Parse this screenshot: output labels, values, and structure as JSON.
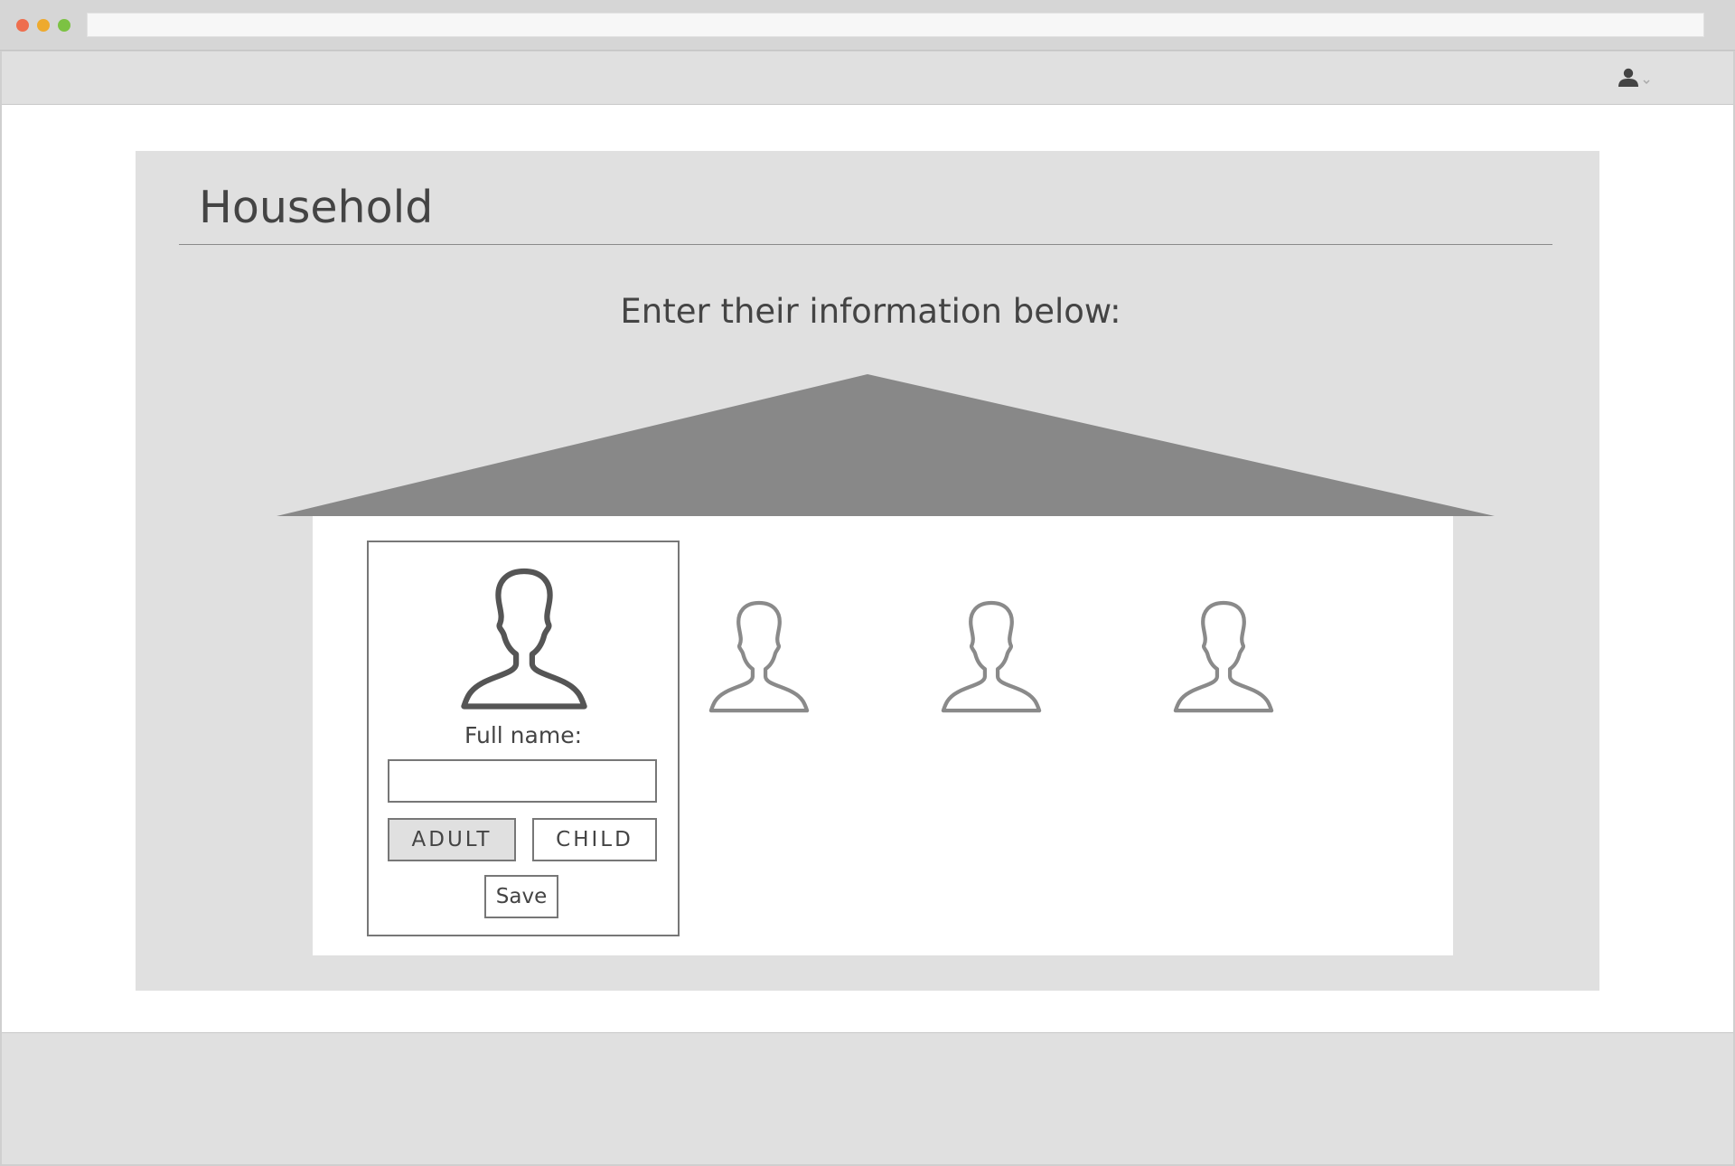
{
  "page": {
    "title": "Household",
    "instructions": "Enter their information below:"
  },
  "member_form": {
    "name_label": "Full name:",
    "name_value": "",
    "name_placeholder": "",
    "adult_label": "ADULT",
    "child_label": "CHILD",
    "selected_type": "ADULT",
    "save_label": "Save"
  },
  "household": {
    "additional_member_slots": 3
  },
  "icons": {
    "user_menu": "user-icon",
    "user_menu_caret": "chevron-down-icon",
    "member": "person-silhouette-icon"
  },
  "colors": {
    "panel_background": "#e0e0e0",
    "roof": "#888888",
    "selected_button": "#e0e0e0",
    "outline": "#777777",
    "text": "#444444",
    "placeholder_avatar": "#8a8a8a",
    "active_avatar": "#555555"
  }
}
